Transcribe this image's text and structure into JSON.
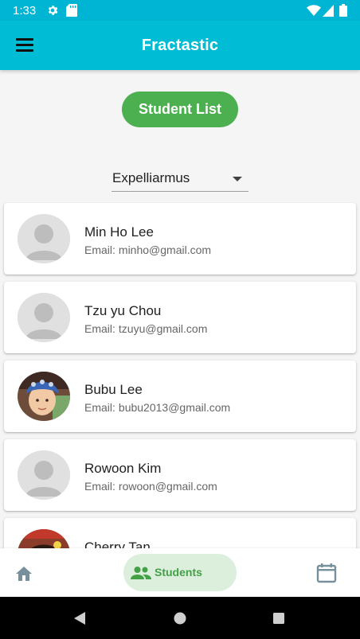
{
  "status_bar": {
    "time": "1:33",
    "icons": [
      "gear-icon",
      "sd-card-icon",
      "wifi-icon",
      "cellular-icon",
      "battery-icon"
    ]
  },
  "app_bar": {
    "title": "Fractastic",
    "menu_icon": "hamburger-menu-icon",
    "background_color": "#00bcd4"
  },
  "header_button": {
    "label": "Student List",
    "color": "#4caf50"
  },
  "class_dropdown": {
    "selected": "Expelliarmus"
  },
  "students": [
    {
      "name": "Min Ho Lee",
      "email_label": "Email:",
      "email": "minho@gmail.com",
      "avatar": "default-avatar"
    },
    {
      "name": "Tzu yu Chou",
      "email_label": "Email:",
      "email": "tzuyu@gmail.com",
      "avatar": "default-avatar"
    },
    {
      "name": "Bubu Lee",
      "email_label": "Email:",
      "email": "bubu2013@gmail.com",
      "avatar": "photo-avatar"
    },
    {
      "name": "Rowoon Kim",
      "email_label": "Email:",
      "email": "rowoon@gmail.com",
      "avatar": "default-avatar"
    },
    {
      "name": "Cherry Tan",
      "email_label": "",
      "email": "",
      "avatar": "photo-avatar"
    }
  ],
  "bottom_nav": {
    "home_icon": "home-icon",
    "students_label": "Students",
    "students_icon": "people-icon",
    "calendar_icon": "calendar-icon",
    "active_color": "#43a047"
  },
  "system_nav": {
    "icons": [
      "back-icon",
      "home-circle-icon",
      "recents-icon"
    ]
  }
}
